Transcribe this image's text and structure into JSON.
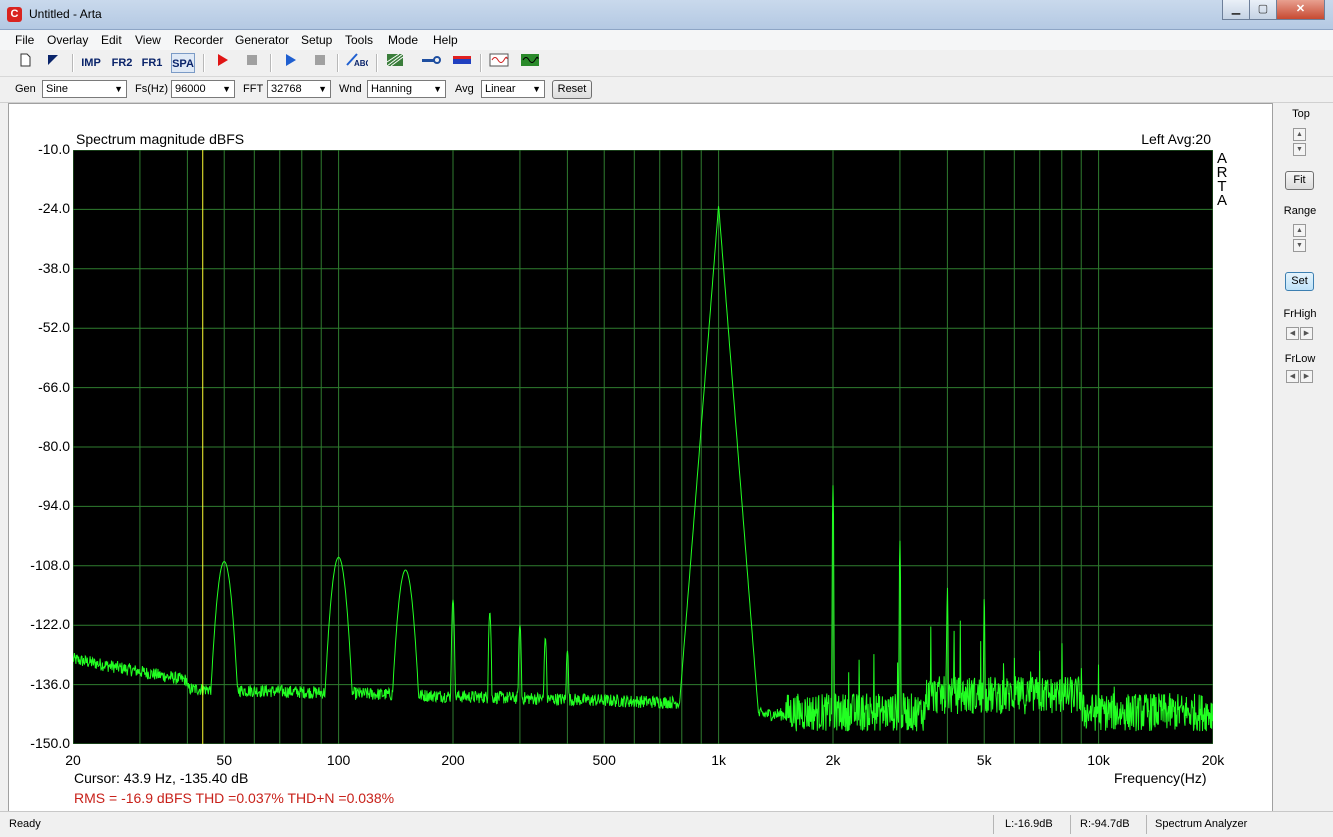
{
  "window": {
    "title": "Untitled - Arta",
    "app_icon": "C"
  },
  "menu": [
    "File",
    "Overlay",
    "Edit",
    "View",
    "Recorder",
    "Generator",
    "Setup",
    "Tools",
    "Mode",
    "Help"
  ],
  "toolbar": {
    "imp": "IMP",
    "fr2": "FR2",
    "fr1": "FR1",
    "spa": "SPA",
    "icons": [
      "new-file-icon",
      "open-icon",
      "record-icon",
      "stop-icon",
      "play-icon",
      "stop2-icon",
      "abc-icon",
      "grid-icon",
      "key-icon",
      "band-icon",
      "sine-icon",
      "green-wave-icon"
    ]
  },
  "controls": {
    "gen_label": "Gen",
    "gen_value": "Sine",
    "fs_label": "Fs(Hz)",
    "fs_value": "96000",
    "fft_label": "FFT",
    "fft_value": "32768",
    "wnd_label": "Wnd",
    "wnd_value": "Hanning",
    "avg_label": "Avg",
    "avg_value": "Linear",
    "reset": "Reset"
  },
  "plot": {
    "title": "Spectrum magnitude dBFS",
    "channel_info": "Left  Avg:20",
    "watermark": [
      "A",
      "R",
      "T",
      "A"
    ],
    "xlabel": "Frequency(Hz)",
    "cursor": "Cursor:    43.9 Hz, -135.40 dB",
    "stats": "RMS =  -16.9 dBFS   THD =0.037%   THD+N =0.038%"
  },
  "right_panel": {
    "top": "Top",
    "fit": "Fit",
    "range": "Range",
    "set": "Set",
    "frhigh": "FrHigh",
    "frlow": "FrLow"
  },
  "status": {
    "ready": "Ready",
    "left": "L:-16.9dB",
    "right": "R:-94.7dB",
    "mode": "Spectrum Analyzer"
  },
  "colors": {
    "plot_bg": "#000000",
    "grid": "#2f7d2f",
    "trace": "#22ff22",
    "cursor": "#ffff33",
    "stats": "#c8211a"
  },
  "chart_data": {
    "type": "line",
    "title": "Spectrum magnitude dBFS",
    "xlabel": "Frequency(Hz)",
    "ylabel": "",
    "x_scale": "log",
    "xlim": [
      20,
      20000
    ],
    "ylim": [
      -150,
      -10
    ],
    "yticks": [
      "-10.0",
      "-24.0",
      "-38.0",
      "-52.0",
      "-66.0",
      "-80.0",
      "-94.0",
      "-108.0",
      "-122.0",
      "-136.0",
      "-150.0"
    ],
    "xticks": [
      {
        "v": 20,
        "label": "20"
      },
      {
        "v": 50,
        "label": "50"
      },
      {
        "v": 100,
        "label": "100"
      },
      {
        "v": 200,
        "label": "200"
      },
      {
        "v": 500,
        "label": "500"
      },
      {
        "v": 1000,
        "label": "1k"
      },
      {
        "v": 2000,
        "label": "2k"
      },
      {
        "v": 5000,
        "label": "5k"
      },
      {
        "v": 10000,
        "label": "10k"
      },
      {
        "v": 20000,
        "label": "20k"
      }
    ],
    "cursor_hz": 43.9,
    "peaks": [
      {
        "hz": 50,
        "db": -107
      },
      {
        "hz": 100,
        "db": -106
      },
      {
        "hz": 150,
        "db": -109
      },
      {
        "hz": 200,
        "db": -116
      },
      {
        "hz": 250,
        "db": -119
      },
      {
        "hz": 300,
        "db": -122
      },
      {
        "hz": 350,
        "db": -125
      },
      {
        "hz": 400,
        "db": -128
      },
      {
        "hz": 1000,
        "db": -23
      },
      {
        "hz": 2000,
        "db": -89
      },
      {
        "hz": 3000,
        "db": -102
      },
      {
        "hz": 4000,
        "db": -113
      },
      {
        "hz": 5000,
        "db": -115
      }
    ],
    "noise_floor_db": -137
  }
}
